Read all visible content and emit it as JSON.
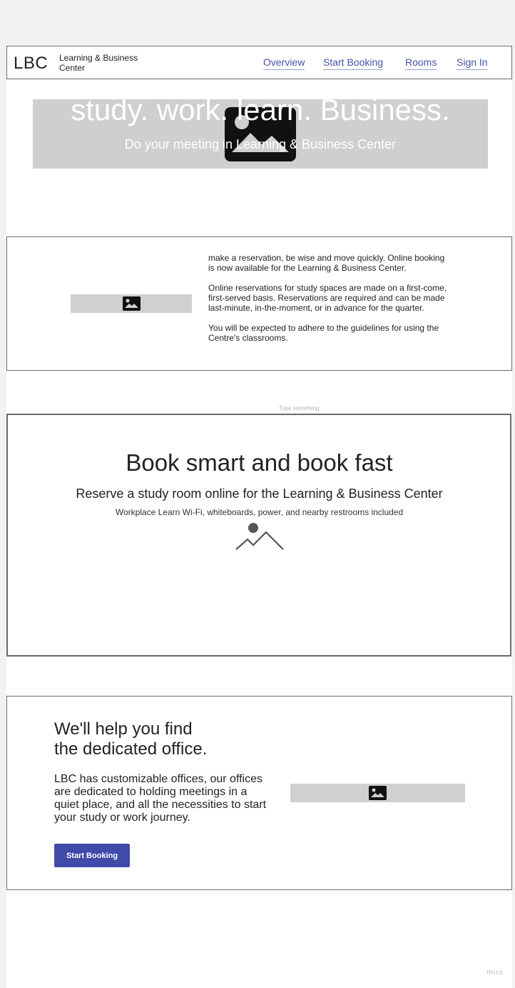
{
  "header": {
    "logo": "LBC",
    "logo_subtitle": "Learning & Business Center",
    "nav": [
      {
        "label": "Overview"
      },
      {
        "label": "Start Booking"
      },
      {
        "label": "Rooms"
      },
      {
        "label": "Sign In"
      }
    ]
  },
  "hero": {
    "title": "study. work. learn. Business.",
    "subtitle": "Do your meeting in Learning & Business Center",
    "image_icon": "image-icon"
  },
  "info": {
    "paragraphs": [
      "make a reservation, be wise and move quickly. Online booking is now available for the Learning & Business Center.",
      "Online reservations for study spaces are made on a first-come, first-served basis. Reservations are required and can be made last-minute, in-the-moment, or in advance for the quarter.",
      "You will be expected to adhere to the guidelines for using the Centre's classrooms."
    ],
    "image_icon": "image-icon"
  },
  "placeholder_text": "Type something",
  "booking": {
    "title": "Book smart and book fast",
    "subtitle": "Reserve a study room online for the Learning & Business Center",
    "details": "Workplace Learn Wi-Fi, whiteboards, power, and nearby restrooms included",
    "image_icon": "mountain-image-icon"
  },
  "office": {
    "title_line1": "We'll help you find",
    "title_line2": "the dedicated office.",
    "body": "LBC has customizable offices, our offices are dedicated to holding meetings in a quiet place, and all the necessities to start your study or work journey.",
    "cta_label": "Start Booking",
    "image_icon": "image-icon"
  },
  "watermark": "miro",
  "colors": {
    "accent": "#3f4aa9",
    "link": "#4652a7",
    "placeholder_gray": "#d0d0d0",
    "background": "#f2f2f2"
  }
}
